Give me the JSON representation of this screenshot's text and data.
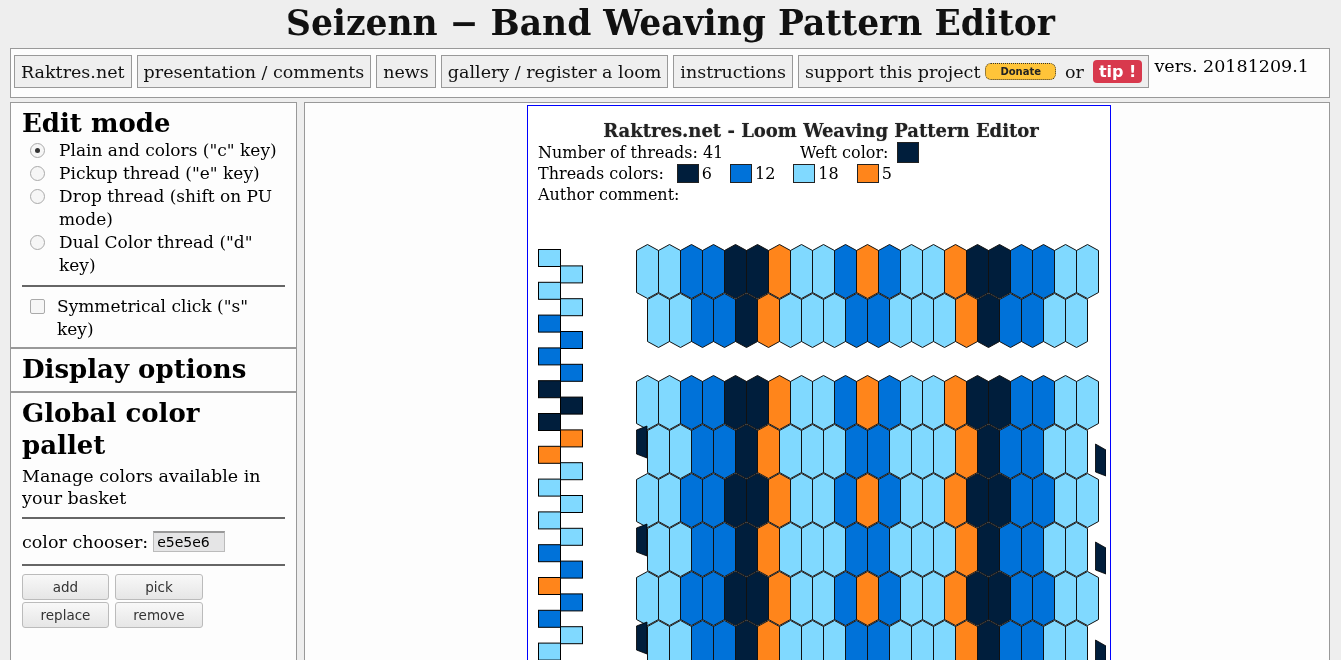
{
  "page_title": "Seizenn − Band Weaving Pattern Editor",
  "nav": {
    "links": [
      "Raktres.net",
      "presentation / comments",
      "news",
      "gallery / register a loom",
      "instructions"
    ],
    "support": {
      "label": "support this project",
      "donate": "Donate",
      "or": "or",
      "tip": "tip !"
    },
    "version": "vers. 20181209.1"
  },
  "sidebar": {
    "edit_mode": {
      "heading": "Edit mode",
      "modes": [
        {
          "label": "Plain and colors (\"c\" key)",
          "selected": true
        },
        {
          "label": "Pickup thread (\"e\" key)",
          "selected": false
        },
        {
          "label": "Drop thread (shift on PU mode)",
          "selected": false
        },
        {
          "label": "Dual Color thread (\"d\" key)",
          "selected": false
        }
      ],
      "symmetrical": {
        "label": "Symmetrical click (\"s\" key)",
        "checked": false
      }
    },
    "display_options": {
      "heading": "Display options"
    },
    "palette": {
      "heading": "Global color pallet",
      "description": "Manage colors available in your basket",
      "chooser_label": "color chooser:",
      "chooser_value": "e5e5e6",
      "buttons": [
        "add",
        "pick",
        "replace",
        "remove"
      ]
    }
  },
  "pattern": {
    "title": "Raktres.net - Loom Weaving Pattern Editor",
    "threads_label": "Number of threads: 41",
    "weft": {
      "label": "Weft color:",
      "color": "#001e3c"
    },
    "colors_label": "Threads colors:",
    "thread_colors": [
      {
        "color": "#001e3c",
        "count": "6"
      },
      {
        "color": "#0072d9",
        "count": "12"
      },
      {
        "color": "#80d9ff",
        "count": "18"
      },
      {
        "color": "#ff851b",
        "count": "5"
      }
    ],
    "comment_label": "Author comment:",
    "threads": [
      {
        "color": "#80d9ff"
      },
      {
        "color": "#80d9ff"
      },
      {
        "color": "#80d9ff"
      },
      {
        "color": "#80d9ff"
      },
      {
        "color": "#0072d9"
      },
      {
        "color": "#0072d9"
      },
      {
        "color": "#0072d9"
      },
      {
        "color": "#0072d9"
      },
      {
        "color": "#001e3c"
      },
      {
        "color": "#001e3c"
      },
      {
        "color": "#001e3c"
      },
      {
        "color": "#ff851b"
      },
      {
        "color": "#ff851b"
      },
      {
        "color": "#80d9ff"
      },
      {
        "color": "#80d9ff"
      },
      {
        "color": "#80d9ff"
      },
      {
        "color": "#80d9ff"
      },
      {
        "color": "#80d9ff"
      },
      {
        "color": "#0072d9"
      },
      {
        "color": "#0072d9"
      },
      {
        "color": "#ff851b"
      },
      {
        "color": "#0072d9"
      },
      {
        "color": "#0072d9"
      },
      {
        "color": "#80d9ff"
      },
      {
        "color": "#80d9ff"
      },
      {
        "color": "#80d9ff"
      },
      {
        "color": "#80d9ff"
      },
      {
        "color": "#80d9ff"
      },
      {
        "color": "#ff851b"
      },
      {
        "color": "#ff851b"
      },
      {
        "color": "#001e3c"
      },
      {
        "color": "#001e3c"
      },
      {
        "color": "#001e3c"
      },
      {
        "color": "#0072d9"
      },
      {
        "color": "#0072d9"
      },
      {
        "color": "#0072d9"
      },
      {
        "color": "#0072d9"
      },
      {
        "color": "#80d9ff"
      },
      {
        "color": "#80d9ff"
      },
      {
        "color": "#80d9ff"
      },
      {
        "color": "#80d9ff"
      }
    ],
    "weft_sequence": [
      {
        "color": "#80d9ff"
      },
      {
        "color": "#80d9ff"
      },
      {
        "color": "#80d9ff"
      },
      {
        "color": "#80d9ff"
      },
      {
        "color": "#0072d9"
      },
      {
        "color": "#0072d9"
      },
      {
        "color": "#0072d9"
      },
      {
        "color": "#0072d9"
      },
      {
        "color": "#001e3c"
      },
      {
        "color": "#001e3c"
      },
      {
        "color": "#001e3c"
      },
      {
        "color": "#ff851b"
      },
      {
        "color": "#ff851b"
      },
      {
        "color": "#80d9ff"
      },
      {
        "color": "#80d9ff"
      },
      {
        "color": "#80d9ff"
      },
      {
        "color": "#80d9ff"
      },
      {
        "color": "#80d9ff"
      },
      {
        "color": "#0072d9"
      },
      {
        "color": "#0072d9"
      },
      {
        "color": "#ff851b"
      },
      {
        "color": "#0072d9"
      },
      {
        "color": "#0072d9"
      },
      {
        "color": "#80d9ff"
      },
      {
        "color": "#80d9ff"
      }
    ]
  }
}
